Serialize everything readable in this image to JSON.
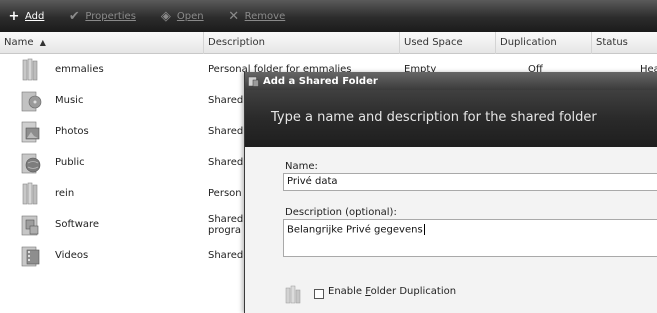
{
  "toolbar": {
    "add": "Add",
    "properties": "Properties",
    "open": "Open",
    "remove": "Remove"
  },
  "columns": {
    "name": "Name",
    "description": "Description",
    "used_space": "Used Space",
    "duplication": "Duplication",
    "status": "Status"
  },
  "folders": [
    {
      "name": "emmalies",
      "description": "Personal folder for emmalies",
      "icon": "user-folder-icon"
    },
    {
      "name": "Music",
      "description": "Shared",
      "icon": "music-folder-icon"
    },
    {
      "name": "Photos",
      "description": "Shared",
      "icon": "photos-folder-icon"
    },
    {
      "name": "Public",
      "description": "Shared",
      "icon": "public-folder-icon"
    },
    {
      "name": "rein",
      "description": "Person",
      "icon": "user-folder-icon"
    },
    {
      "name": "Software",
      "description_line1": "Shared",
      "description_line2": "progra",
      "icon": "software-folder-icon"
    },
    {
      "name": "Videos",
      "description": "Shared",
      "icon": "videos-folder-icon"
    }
  ],
  "first_row_extra": {
    "used_space": "Empty",
    "duplication": "Off",
    "status": "Heal"
  },
  "dialog": {
    "title": "Add a Shared Folder",
    "heading": "Type a name and description for the shared folder",
    "name_label": "Name:",
    "name_value": "Privé data",
    "description_label": "Description (optional):",
    "description_value": "Belangrijke Privé gegevens",
    "enable_duplication_label": "Enable Folder Duplication",
    "enable_duplication_checked": false
  },
  "colors": {
    "toolbar_dark": "#1b1b1b",
    "dialog_banner": "#2a2a2a",
    "dialog_body": "#f3f3f3"
  }
}
